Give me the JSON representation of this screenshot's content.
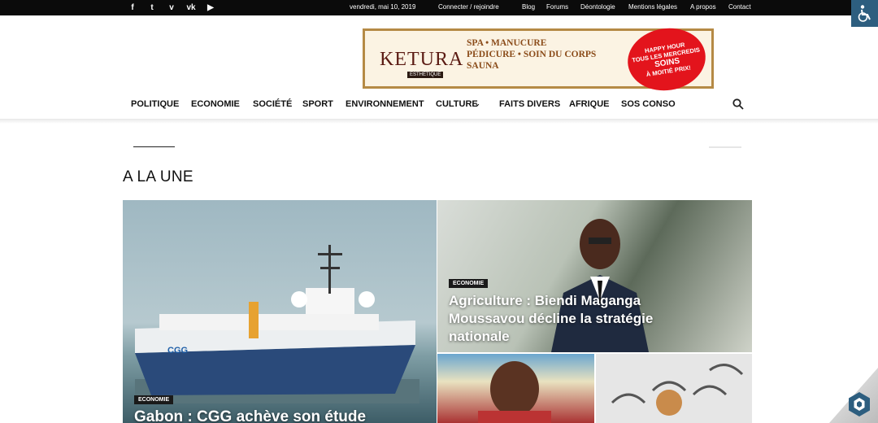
{
  "topbar": {
    "social_icons": [
      "facebook-icon",
      "twitter-icon",
      "vimeo-icon",
      "vk-icon",
      "youtube-icon"
    ],
    "social_glyphs": [
      "f",
      "t",
      "v",
      "vk",
      "▶"
    ],
    "date": "vendredi, mai 10, 2019",
    "login": "Connecter / rejoindre",
    "links": [
      "Blog",
      "Forums",
      "Déontologie",
      "Mentions légales",
      "A propos",
      "Contact"
    ]
  },
  "banner": {
    "brand": "KETURA",
    "brand_sub": "ESTHÉTIQUE",
    "services": [
      "SPA • MANUCURE",
      "PÉDICURE • SOIN DU CORPS",
      "SAUNA"
    ],
    "promo": [
      "HAPPY HOUR",
      "TOUS LES MERCREDIS",
      "SOINS",
      "À MOITIÉ PRIX!"
    ]
  },
  "nav": {
    "items": [
      "POLITIQUE",
      "ECONOMIE",
      "SOCIÉTÉ",
      "SPORT",
      "ENVIRONNEMENT",
      "CULTURE",
      "FAITS DIVERS",
      "AFRIQUE",
      "SOS CONSO"
    ]
  },
  "section_title": "A LA UNE",
  "articles": [
    {
      "category": "ECONOMIE",
      "title": "Gabon : CGG achève son étude"
    },
    {
      "category": "ECONOMIE",
      "title": "Agriculture : Biendi Maganga Moussavou décline la stratégie nationale"
    }
  ],
  "colors": {
    "topbar": "#0b0b0b",
    "accessibility": "#2d5e7f",
    "promo_red": "#e3141c"
  }
}
